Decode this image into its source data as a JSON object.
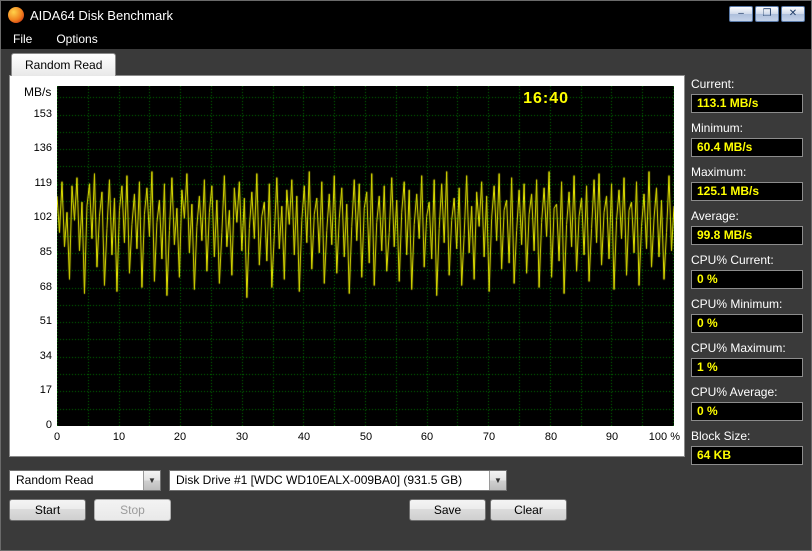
{
  "window": {
    "title": "AIDA64 Disk Benchmark",
    "controls": [
      {
        "name": "minimize",
        "glyph": "–"
      },
      {
        "name": "maximize",
        "glyph": "❐"
      },
      {
        "name": "close",
        "glyph": "✕"
      }
    ]
  },
  "menu": {
    "file": "File",
    "options": "Options"
  },
  "tab": {
    "label": "Random Read"
  },
  "chart_data": {
    "type": "line",
    "title": "Random Read disk benchmark",
    "ylabel": "MB/s",
    "elapsed_time": "16:40",
    "y_ticks": [
      153,
      136,
      119,
      102,
      85,
      68,
      51,
      34,
      17,
      0
    ],
    "x_ticks": [
      "0",
      "10",
      "20",
      "30",
      "40",
      "50",
      "60",
      "70",
      "80",
      "90",
      "100 %"
    ],
    "ylim": [
      0,
      167
    ],
    "xlim": [
      0,
      100
    ],
    "x_grid_step": 5,
    "y_grid_step": 8.5,
    "grid_on": true,
    "bg": "#000000",
    "grid_color": "#007400",
    "line_color": "#ffff00",
    "values": [
      113,
      95,
      120,
      88,
      105,
      72,
      118,
      101,
      122,
      86,
      110,
      65,
      108,
      119,
      92,
      124,
      78,
      103,
      115,
      69,
      97,
      121,
      84,
      112,
      66,
      106,
      118,
      90,
      123,
      75,
      99,
      114,
      87,
      120,
      68,
      104,
      117,
      93,
      125,
      71,
      100,
      111,
      82,
      119,
      64,
      96,
      122,
      89,
      107,
      73,
      116,
      102,
      124,
      85,
      109,
      67,
      98,
      113,
      91,
      121,
      76,
      105,
      118,
      83,
      111,
      70,
      95,
      123,
      88,
      106,
      74,
      117,
      100,
      120,
      86,
      112,
      63,
      97,
      115,
      92,
      124,
      79,
      103,
      110,
      81,
      119,
      68,
      94,
      122,
      87,
      108,
      72,
      116,
      99,
      121,
      84,
      113,
      66,
      101,
      118,
      90,
      125,
      77,
      104,
      112,
      85,
      120,
      70,
      96,
      114,
      89,
      123,
      75,
      102,
      117,
      83,
      109,
      65,
      98,
      121,
      91,
      119,
      73,
      107,
      115,
      80,
      124,
      69,
      100,
      113,
      86,
      118,
      76,
      95,
      122,
      88,
      111,
      71,
      105,
      120,
      84,
      116,
      67,
      99,
      114,
      92,
      123,
      78,
      103,
      110,
      82,
      121,
      64,
      97,
      119,
      90,
      125,
      74,
      101,
      112,
      87,
      117,
      69,
      94,
      123,
      85,
      108,
      72,
      115,
      98,
      120,
      83,
      113,
      66,
      102,
      118,
      91,
      124,
      77,
      106,
      111,
      80,
      122,
      70,
      96,
      116,
      89,
      119,
      75,
      104,
      114,
      86,
      121,
      68,
      100,
      117,
      93,
      125,
      73,
      107,
      109,
      81,
      120,
      65,
      99,
      115,
      88,
      123,
      76,
      103,
      112,
      84,
      118,
      71,
      97,
      121,
      90,
      124,
      79,
      105,
      113,
      82,
      119,
      67,
      101,
      116,
      92,
      122,
      74,
      106,
      110,
      85,
      120,
      69,
      98,
      114,
      87,
      125,
      78,
      102,
      117,
      83,
      111,
      72,
      95,
      123,
      86,
      108
    ]
  },
  "stats": [
    {
      "label": "Current:",
      "value": "113.1 MB/s"
    },
    {
      "label": "Minimum:",
      "value": "60.4 MB/s"
    },
    {
      "label": "Maximum:",
      "value": "125.1 MB/s"
    },
    {
      "label": "Average:",
      "value": "99.8 MB/s"
    },
    {
      "label": "CPU% Current:",
      "value": "0 %"
    },
    {
      "label": "CPU% Minimum:",
      "value": "0 %"
    },
    {
      "label": "CPU% Maximum:",
      "value": "1 %"
    },
    {
      "label": "CPU% Average:",
      "value": "0 %"
    },
    {
      "label": "Block Size:",
      "value": "64 KB"
    }
  ],
  "controls": {
    "benchmark_select": "Random Read",
    "drive_select": "Disk Drive #1  [WDC WD10EALX-009BA0]  (931.5 GB)",
    "start": "Start",
    "stop": "Stop",
    "save": "Save",
    "clear": "Clear"
  }
}
